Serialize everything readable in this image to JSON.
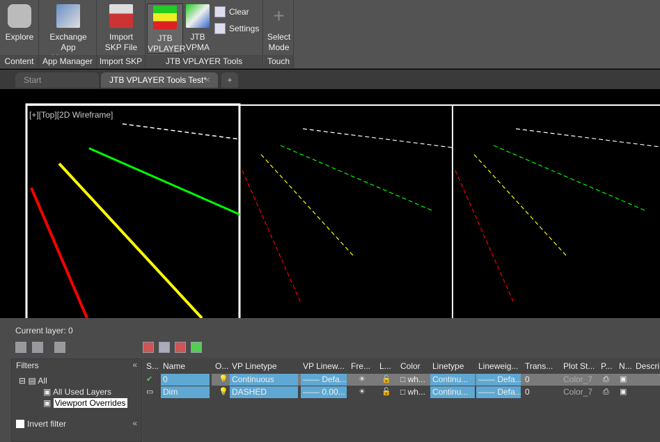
{
  "ribbon": {
    "panels": [
      {
        "label": "Content",
        "buttons": [
          {
            "label": "Explore",
            "icon": "binoculars-icon"
          }
        ]
      },
      {
        "label": "App Manager",
        "buttons": [
          {
            "label": "Exchange App Manager",
            "icon": "exchange-icon"
          }
        ]
      },
      {
        "label": "Import SKP",
        "buttons": [
          {
            "label": "Import SKP File",
            "icon": "skp-import-icon"
          }
        ]
      },
      {
        "label": "JTB VPLAYER Tools",
        "buttons": [
          {
            "label": "JTB VPLAYER",
            "icon": "layers-icon"
          },
          {
            "label": "JTB VPMA",
            "icon": "vpma-icon"
          },
          {
            "label": "Clear",
            "icon": "clear-icon"
          },
          {
            "label": "Settings",
            "icon": "settings-icon"
          }
        ]
      },
      {
        "label": "Touch",
        "buttons": [
          {
            "label": "Select Mode",
            "icon": "crosshair-icon"
          }
        ]
      }
    ]
  },
  "tabs": [
    {
      "label": "Start"
    },
    {
      "label": "JTB VPLAYER Tools Test*",
      "active": true
    }
  ],
  "viewport": {
    "label": "[+][Top][2D Wireframe]"
  },
  "layers": {
    "current_layer": "Current layer: 0",
    "filters_title": "Filters",
    "tree": [
      "All",
      "All Used Layers",
      "Viewport Overrides"
    ],
    "invert_filter": "Invert filter",
    "columns": [
      "S...",
      "Name",
      "O...",
      "VP Linetype",
      "VP Linew...",
      "Fre...",
      "L...",
      "Color",
      "Linetype",
      "Lineweig...",
      "Trans...",
      "Plot St...",
      "P...",
      "N...",
      "Descrip"
    ],
    "rows": [
      {
        "name": "0",
        "vp_linetype": "Continuous",
        "vp_lineweight": "Defa...",
        "color": "wh...",
        "linetype": "Continu...",
        "lineweight": "Defa...",
        "transparency": "0",
        "plot_style": "Color_7",
        "current": true
      },
      {
        "name": "Dim",
        "vp_linetype": "DASHED",
        "vp_lineweight": "0.00...",
        "color": "wh...",
        "linetype": "Continu...",
        "lineweight": "Defa...",
        "transparency": "0",
        "plot_style": "Color_7",
        "current": false
      }
    ]
  },
  "colors": {
    "red": "#ff0000",
    "yellow": "#ffff00",
    "green": "#00ff00",
    "white": "#ffffff",
    "selection": "#5fa8d3"
  }
}
